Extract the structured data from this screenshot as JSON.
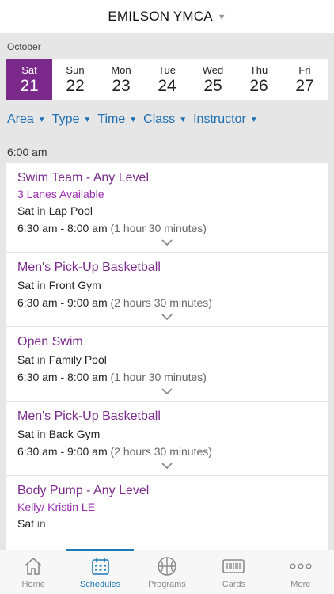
{
  "header": {
    "title": "EMILSON YMCA"
  },
  "calendar": {
    "month": "October",
    "days": [
      {
        "name": "Sat",
        "num": "21"
      },
      {
        "name": "Sun",
        "num": "22"
      },
      {
        "name": "Mon",
        "num": "23"
      },
      {
        "name": "Tue",
        "num": "24"
      },
      {
        "name": "Wed",
        "num": "25"
      },
      {
        "name": "Thu",
        "num": "26"
      },
      {
        "name": "Fri",
        "num": "27"
      }
    ]
  },
  "filters": [
    "Area",
    "Type",
    "Time",
    "Class",
    "Instructor"
  ],
  "schedule": {
    "time_header": "6:00 am",
    "items": [
      {
        "name": "Swim Team - Any Level",
        "sub": "3 Lanes Available",
        "day": "Sat",
        "in": "in",
        "location": "Lap Pool",
        "time": "6:30 am - 8:00 am",
        "duration": "(1 hour 30 minutes)"
      },
      {
        "name": "Men's Pick-Up Basketball",
        "sub": "",
        "day": "Sat",
        "in": "in",
        "location": "Front Gym",
        "time": "6:30 am - 9:00 am",
        "duration": "(2 hours 30 minutes)"
      },
      {
        "name": "Open Swim",
        "sub": "",
        "day": "Sat",
        "in": "in",
        "location": "Family Pool",
        "time": "6:30 am - 8:00 am",
        "duration": "(1 hour 30 minutes)"
      },
      {
        "name": "Men's Pick-Up Basketball",
        "sub": "",
        "day": "Sat",
        "in": "in",
        "location": "Back Gym",
        "time": "6:30 am - 9:00 am",
        "duration": "(2 hours 30 minutes)"
      },
      {
        "name": "Body Pump - Any Level",
        "sub": "Kelly/ Kristin LE",
        "day": "Sat",
        "in": "in",
        "location": "",
        "time": "",
        "duration": ""
      }
    ]
  },
  "tabs": [
    {
      "label": "Home",
      "icon": "home-icon"
    },
    {
      "label": "Schedules",
      "icon": "calendar-icon"
    },
    {
      "label": "Programs",
      "icon": "basketball-icon"
    },
    {
      "label": "Cards",
      "icon": "barcode-card-icon"
    },
    {
      "label": "More",
      "icon": "more-dots-icon"
    }
  ],
  "colors": {
    "accent_purple": "#7b2a8c",
    "link_blue": "#1e6fb3",
    "tab_active": "#1e7ab8"
  }
}
